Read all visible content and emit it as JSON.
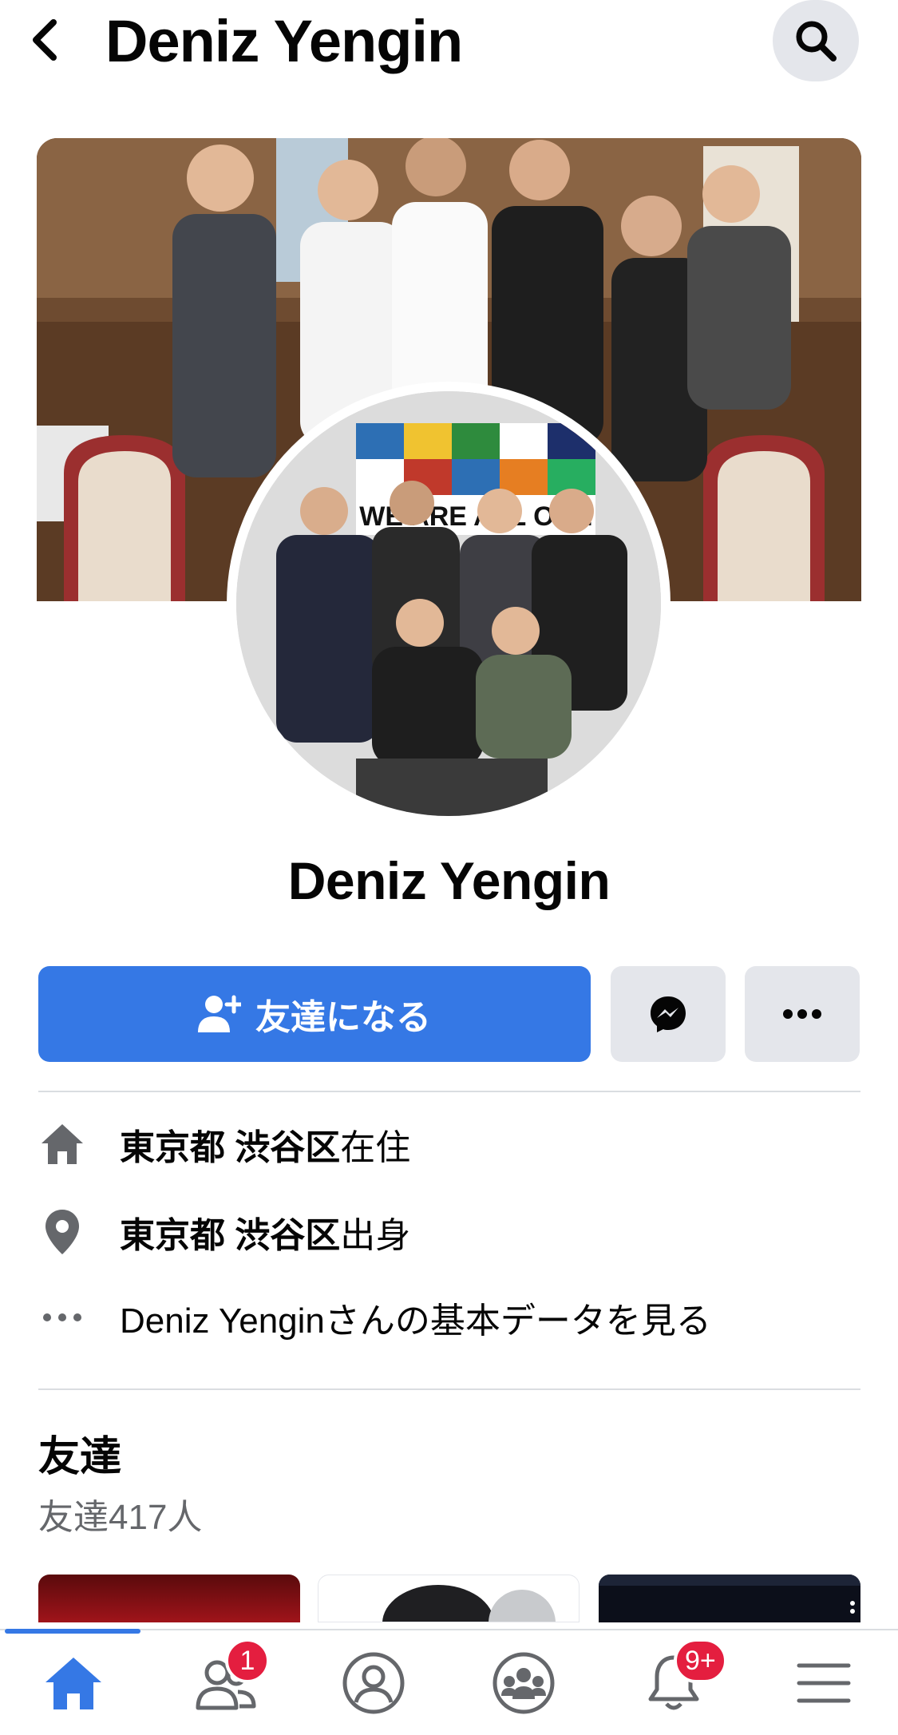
{
  "header": {
    "title": "Deniz Yengin"
  },
  "cover": {
    "banner_text": "WE ARE ALL ONE"
  },
  "profile": {
    "name": "Deniz Yengin"
  },
  "actions": {
    "add_friend_label": "友達になる"
  },
  "info": {
    "lives_bold": "東京都 渋谷区",
    "lives_suffix": "在住",
    "from_bold": "東京都 渋谷区",
    "from_suffix": "出身",
    "about_link": "Deniz Yenginさんの基本データを見る"
  },
  "friends": {
    "title": "友達",
    "count_label": "友達417人"
  },
  "tabbar": {
    "friends_badge": "1",
    "notifications_badge": "9+"
  },
  "colors": {
    "accent": "#3578e5",
    "badge": "#e41e3f",
    "button_gray": "#e4e6eb"
  }
}
